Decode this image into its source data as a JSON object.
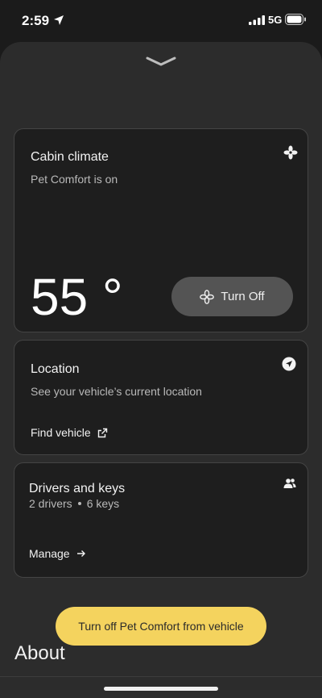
{
  "status": {
    "time": "2:59",
    "network": "5G"
  },
  "climate": {
    "title": "Cabin climate",
    "subtitle": "Pet Comfort is on",
    "temperature": "55 °",
    "button_label": "Turn Off"
  },
  "location": {
    "title": "Location",
    "subtitle": "See your vehicle’s current location",
    "link_label": "Find vehicle"
  },
  "drivers": {
    "title": "Drivers and keys",
    "drivers_count": "2 drivers",
    "keys_count": "6 keys",
    "link_label": "Manage"
  },
  "banner": {
    "label": "Turn off Pet Comfort from vehicle"
  },
  "about": {
    "label": "About"
  },
  "colors": {
    "accent": "#f4d35e",
    "card_bg": "#1e1e1e",
    "sheet_bg": "#2c2c2c"
  }
}
